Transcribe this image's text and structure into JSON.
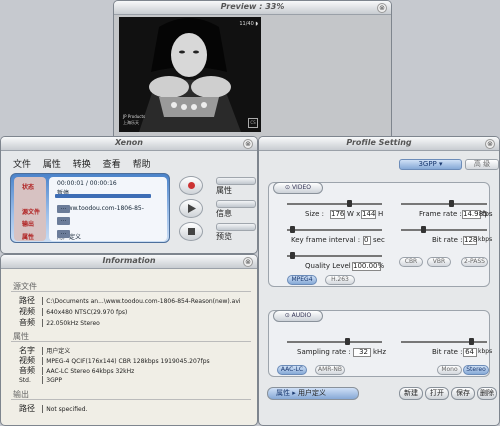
{
  "preview": {
    "title": "Preview : 33%",
    "close": "⊗",
    "overlay": {
      "top_right": "11/40 ◗",
      "bottom_left_1": "JP Products",
      "bottom_left_2": "上海乐天",
      "logo": "CS"
    }
  },
  "xenon": {
    "title": "Xenon",
    "close": "⊗",
    "menu": [
      "文件",
      "属性",
      "转换",
      "查看",
      "帮助"
    ],
    "lcd": {
      "labels": [
        "状态",
        "源文件",
        "输出",
        "属性"
      ],
      "time": "00:00:01 / 00:00:16",
      "status": "暂停...",
      "source": "...www.toodou.com-1806-85-",
      "output": "",
      "profile": "用户定义",
      "more": "..."
    },
    "side": [
      "属性",
      "信息",
      "预览"
    ]
  },
  "info": {
    "title": "Information",
    "close": "⊗",
    "source_header": "源文件",
    "source": [
      {
        "k": "路径",
        "v": "C:\\Documents an...\\www.toodou.com-1806-854-Reason(new).avi"
      },
      {
        "k": "视频",
        "v": "640x480 NTSC(29.970 fps)"
      },
      {
        "k": "音频",
        "v": "22.050kHz Stereo"
      }
    ],
    "profile_header": "属性",
    "profile": [
      {
        "k": "名字",
        "v": "用户定义"
      },
      {
        "k": "视频",
        "v": "MPEG-4 QCIF(176x144) CBR 128kbps 1919045.207fps"
      },
      {
        "k": "音频",
        "v": "AAC-LC Stereo 64kbps 32kHz"
      },
      {
        "k": "Std.",
        "v": "3GPP"
      }
    ],
    "output_header": "输出",
    "output": [
      {
        "k": "路径",
        "v": "Not specified."
      }
    ]
  },
  "profile": {
    "title": "Profile Setting",
    "close": "⊗",
    "format": "3GPP",
    "format_other": "高 级",
    "video": {
      "label": "⊙ VIDEO",
      "size_label": "Size :",
      "width": "176",
      "w": "W x",
      "height": "144",
      "h": "H",
      "framerate_label": "Frame rate :",
      "framerate": "14.985",
      "fps": "fps",
      "keyframe_label": "Key frame interval :",
      "keyframe": "0",
      "sec": "sec",
      "bitrate_label": "Bit rate :",
      "bitrate": "128",
      "kbps": "kbps",
      "quality_label": "Quality Level :",
      "quality": "100.00%",
      "cbr": "CBR",
      "vbr": "VBR",
      "twopass": "2-PASS",
      "mpeg4": "MPEG4",
      "h263": "H.263"
    },
    "audio": {
      "label": "⊙ AUDIO",
      "sampling_label": "Sampling rate :",
      "sampling": "32",
      "khz": "kHz",
      "bitrate_label": "Bit rate :",
      "bitrate": "64",
      "kbps": "kbps",
      "aac": "AAC-LC",
      "amr": "AMR-NB",
      "mono": "Mono",
      "stereo": "Stereo"
    },
    "footer": {
      "attr_label": "属性",
      "arrow": "▸",
      "attr_value": "用户定义",
      "new": "新建",
      "open": "打开",
      "save": "保存",
      "delete": "删除"
    }
  }
}
